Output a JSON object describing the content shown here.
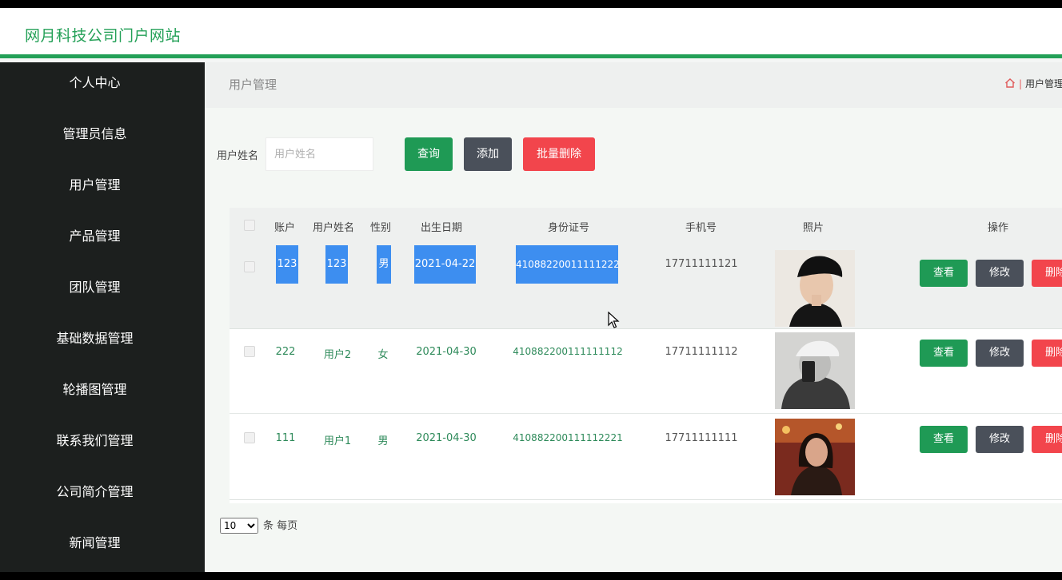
{
  "header": {
    "site_title": "网月科技公司门户网站"
  },
  "sidebar": {
    "items": [
      {
        "label": "个人中心"
      },
      {
        "label": "管理员信息"
      },
      {
        "label": "用户管理"
      },
      {
        "label": "产品管理"
      },
      {
        "label": "团队管理"
      },
      {
        "label": "基础数据管理"
      },
      {
        "label": "轮播图管理"
      },
      {
        "label": "联系我们管理"
      },
      {
        "label": "公司简介管理"
      },
      {
        "label": "新闻管理"
      }
    ]
  },
  "breadcrumb": {
    "title": "用户管理",
    "right_label": "用户管理"
  },
  "search": {
    "label": "用户姓名",
    "placeholder": "用户姓名",
    "value": ""
  },
  "toolbar": {
    "query": "查询",
    "add": "添加",
    "batch_delete": "批量删除"
  },
  "table": {
    "columns": [
      "账户",
      "用户姓名",
      "性别",
      "出生日期",
      "身份证号",
      "手机号",
      "照片",
      "操作"
    ],
    "rows": [
      {
        "account": "123",
        "name": "123",
        "gender": "男",
        "birth": "2021-04-22",
        "idcard": "410882200111112222",
        "phone": "17711111121"
      },
      {
        "account": "222",
        "name": "用户2",
        "gender": "女",
        "birth": "2021-04-30",
        "idcard": "410882200111111112",
        "phone": "17711111112"
      },
      {
        "account": "111",
        "name": "用户1",
        "gender": "男",
        "birth": "2021-04-30",
        "idcard": "410882200111112221",
        "phone": "17711111111"
      }
    ],
    "actions": {
      "view": "查看",
      "edit": "修改",
      "delete": "删除"
    }
  },
  "pagination": {
    "page_size": "10",
    "per_page_label": "条 每页"
  },
  "colors": {
    "brand_green": "#23a057",
    "sidebar_bg": "#1c1f1e",
    "button_green": "#1f9a55",
    "button_dark": "#4a505a",
    "button_red": "#f2454c",
    "selection": "#3d8ef0"
  },
  "icons": [
    "home-icon",
    "mouse-cursor-icon"
  ]
}
